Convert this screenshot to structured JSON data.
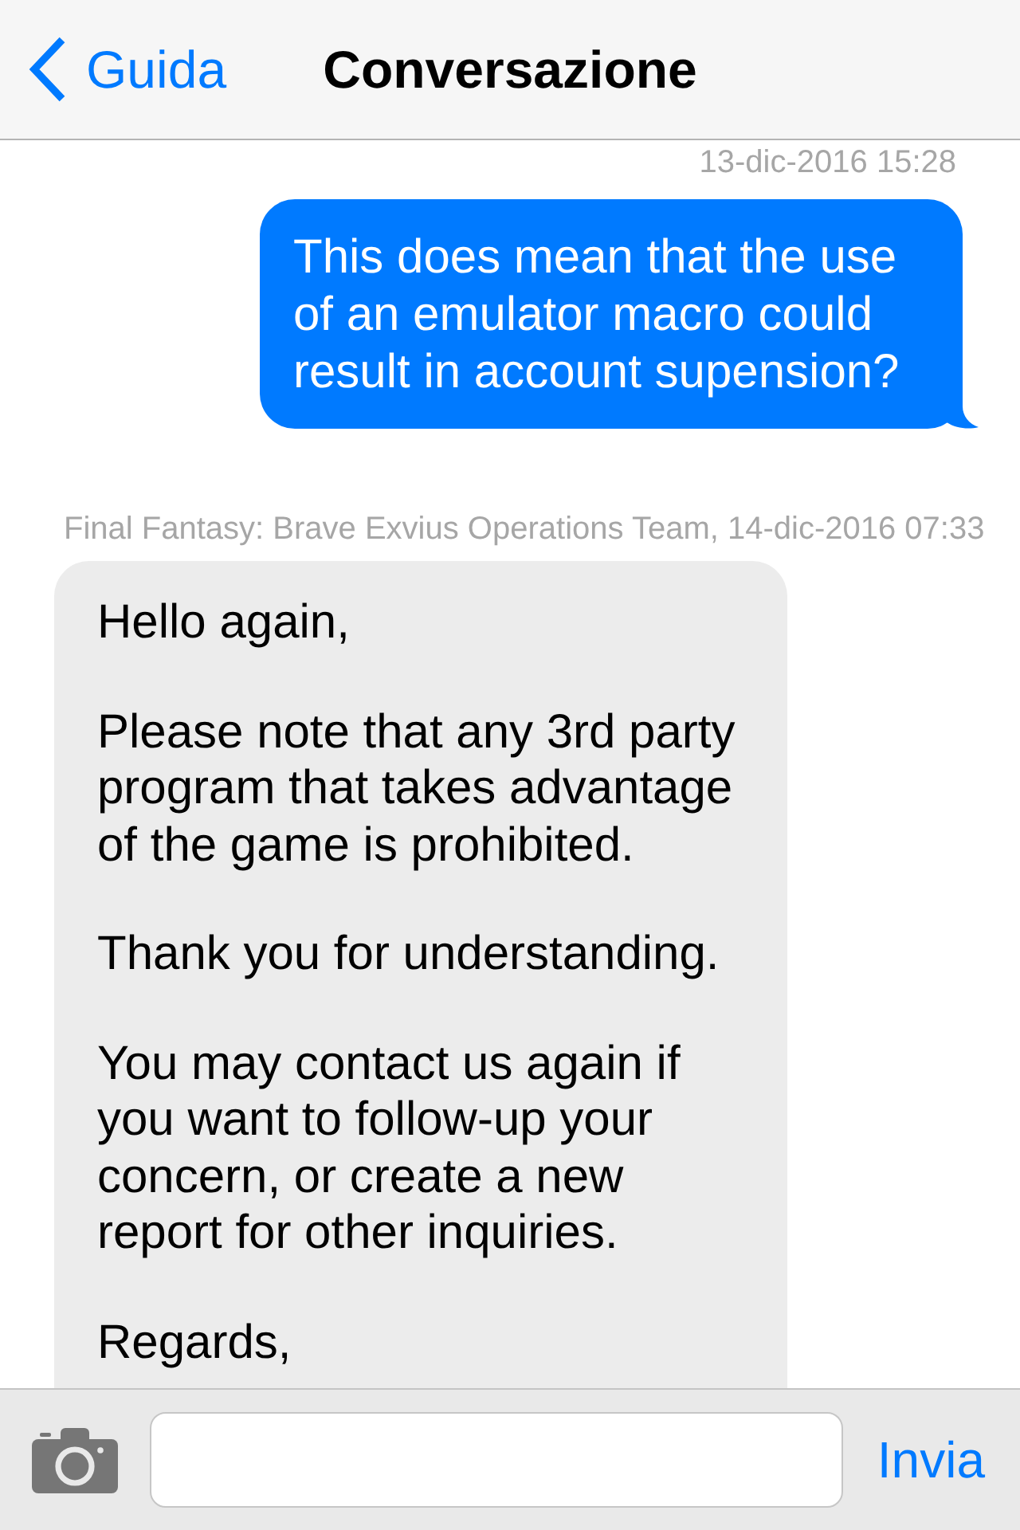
{
  "nav_bar": {
    "back": "Guida",
    "title": "Conversazione"
  },
  "messages": [
    {
      "kind": "outgoing",
      "meta": "13-dic-2016 15:28",
      "paragraphs": [
        "This does mean that the use of an emulator macro could result in account supension?"
      ]
    },
    {
      "kind": "incoming",
      "meta": "Final Fantasy: Brave Exvius Operations Team, 14-dic-2016 07:33",
      "paragraphs": [
        "Hello again,",
        "Please note that any 3rd party program that takes advantage of the game is prohibited.",
        "Thank you for understanding.",
        "You may contact us again if you want to follow-up your concern, or create a new report for other inquiries.",
        "Regards,"
      ]
    }
  ],
  "composer": {
    "send": "Invia"
  }
}
